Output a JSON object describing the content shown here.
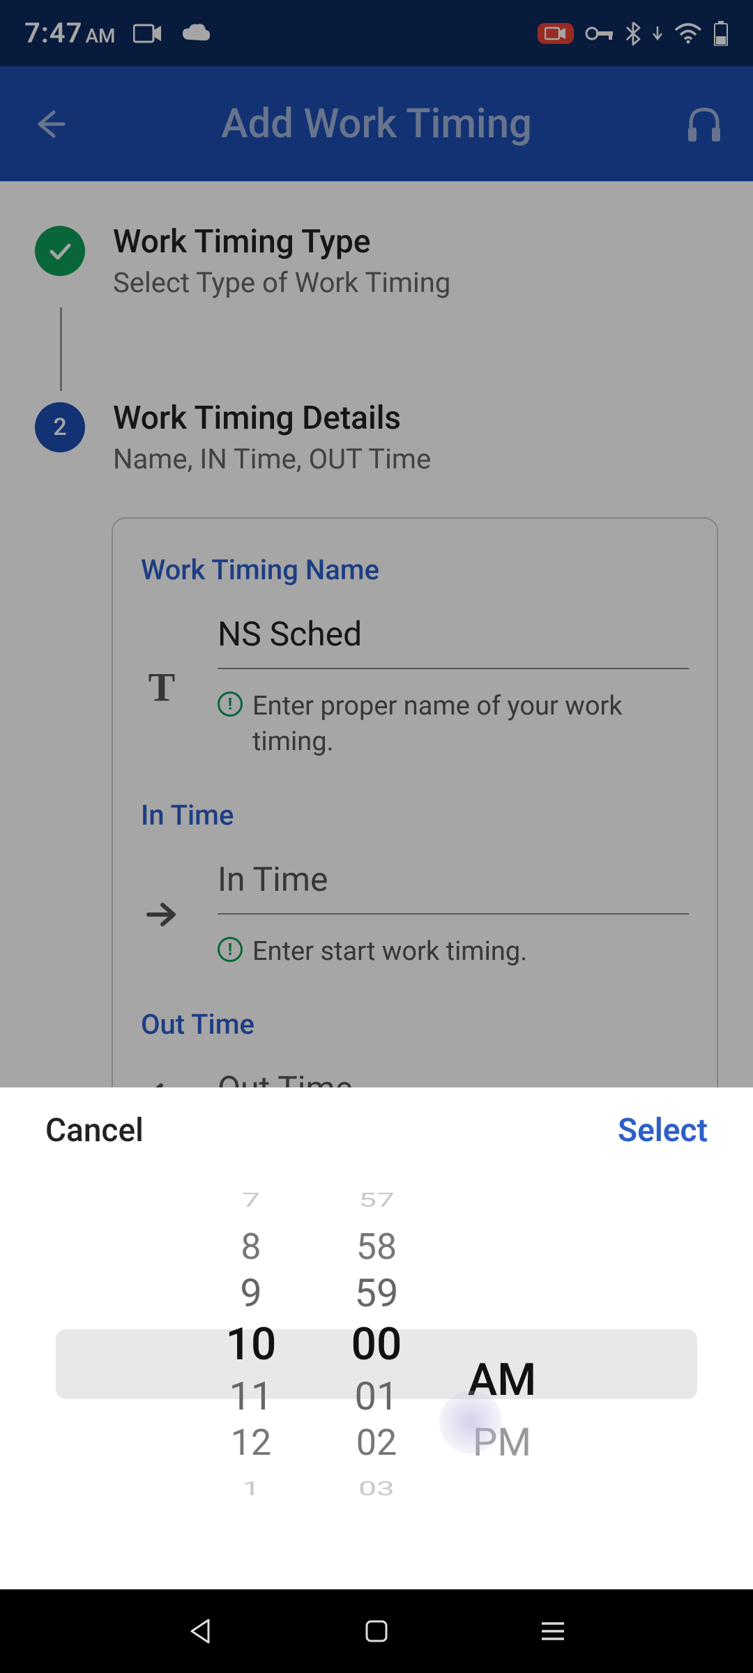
{
  "status": {
    "time": "7:47",
    "ampm": "AM"
  },
  "header": {
    "title": "Add Work Timing"
  },
  "steps": {
    "type": {
      "title": "Work Timing Type",
      "sub": "Select Type of Work Timing"
    },
    "details": {
      "num": "2",
      "title": "Work Timing Details",
      "sub": "Name, IN Time, OUT Time"
    }
  },
  "form": {
    "name": {
      "label": "Work Timing Name",
      "value": "NS Sched",
      "hint": "Enter proper name of your work timing."
    },
    "in": {
      "label": "In Time",
      "placeholder": "In Time",
      "hint": "Enter start work timing."
    },
    "out": {
      "label": "Out Time",
      "placeholder": "Out Time"
    }
  },
  "picker": {
    "cancel": "Cancel",
    "select": "Select",
    "hours": [
      "7",
      "8",
      "9",
      "10",
      "11",
      "12",
      "1"
    ],
    "minutes": [
      "57",
      "58",
      "59",
      "00",
      "01",
      "02",
      "03"
    ],
    "ampm": [
      "AM",
      "PM"
    ],
    "selected": {
      "hour": "10",
      "minute": "00",
      "ampm": "AM"
    }
  }
}
